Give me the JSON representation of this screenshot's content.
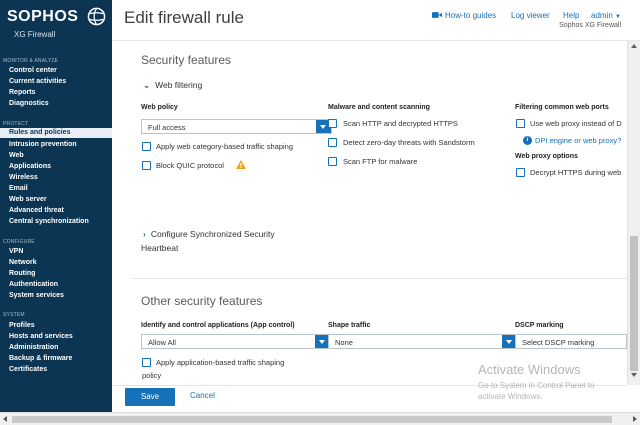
{
  "brand": {
    "name": "SOPHOS",
    "product": "XG Firewall"
  },
  "sidebar": {
    "sections": [
      {
        "title": "MONITOR & ANALYZE",
        "items": [
          "Control center",
          "Current activities",
          "Reports",
          "Diagnostics"
        ]
      },
      {
        "title": "PROTECT",
        "items": [
          "Rules and policies",
          "Intrusion prevention",
          "Web",
          "Applications",
          "Wireless",
          "Email",
          "Web server",
          "Advanced threat",
          "Central synchronization"
        ]
      },
      {
        "title": "CONFIGURE",
        "items": [
          "VPN",
          "Network",
          "Routing",
          "Authentication",
          "System services"
        ]
      },
      {
        "title": "SYSTEM",
        "items": [
          "Profiles",
          "Hosts and services",
          "Administration",
          "Backup & firmware",
          "Certificates"
        ]
      }
    ],
    "active_item": "Rules and policies"
  },
  "header": {
    "title": "Edit firewall rule",
    "links": {
      "howto": "How-to guides",
      "log_viewer": "Log viewer",
      "help": "Help",
      "user": "admin"
    },
    "subtitle": "Sophos XG Firewall"
  },
  "security_features": {
    "title": "Security features",
    "web_filtering_toggle": "Web filtering",
    "web_policy": {
      "label": "Web policy",
      "value": "Full access"
    },
    "apply_web_category": "Apply web category-based traffic shaping",
    "block_quic": "Block QUIC protocol",
    "malware": {
      "label": "Malware and content scanning",
      "scan_http": "Scan HTTP and decrypted HTTPS",
      "zero_day": "Detect zero-day threats with Sandstorm",
      "scan_ftp": "Scan FTP for malware"
    },
    "filtering_ports": {
      "label": "Filtering common web ports",
      "use_proxy": "Use web proxy instead of D",
      "dpi_link": "DPI engine or web proxy?"
    },
    "web_proxy": {
      "label": "Web proxy options",
      "decrypt": "Decrypt HTTPS during web"
    },
    "sync_security_toggle_line1": "Configure Synchronized Security",
    "sync_security_toggle_line2": "Heartbeat"
  },
  "other_features": {
    "title": "Other security features",
    "app_control": {
      "label": "Identify and control applications (App control)",
      "value": "Allow All"
    },
    "shape_traffic": {
      "label": "Shape traffic",
      "value": "None"
    },
    "dscp": {
      "label": "DSCP marking",
      "value": "Select DSCP marking"
    },
    "apply_app_shaping_line1": "Apply application-based traffic shaping",
    "apply_app_shaping_line2": "policy"
  },
  "footer": {
    "save": "Save",
    "cancel": "Cancel"
  },
  "watermark": {
    "title": "Activate Windows",
    "line1": "Go to System in Control Panel to",
    "line2": "activate Windows."
  },
  "colors": {
    "sidebar_bg": "#0b3552",
    "accent": "#1671b8",
    "warning": "#f0a21c"
  }
}
